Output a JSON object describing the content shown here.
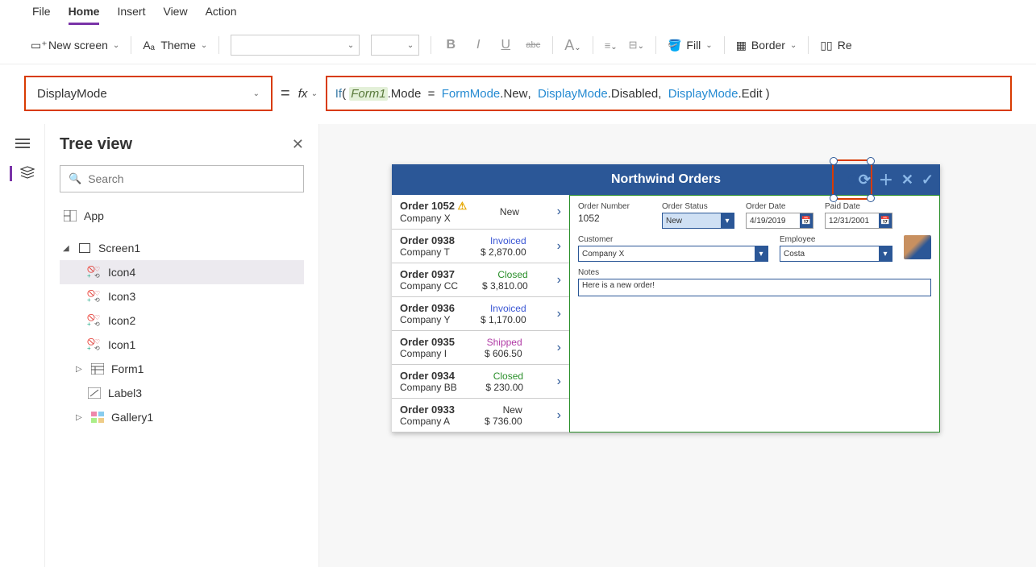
{
  "menu": {
    "file": "File",
    "home": "Home",
    "insert": "Insert",
    "view": "View",
    "action": "Action"
  },
  "ribbon": {
    "new_screen": "New screen",
    "theme": "Theme",
    "fill": "Fill",
    "border": "Border",
    "reorder": "Re"
  },
  "prop_name": "DisplayMode",
  "formula": {
    "if": "If",
    "form1": "Form1",
    "mode": ".Mode",
    "eq": "  =  ",
    "formmode": "FormMode",
    "new": ".New",
    "c1": ",  ",
    "dm1": "DisplayMode",
    "dis": ".Disabled",
    "c2": ",  ",
    "dm2": "DisplayMode",
    "edit": ".Edit ",
    "open": "( ",
    "close": ")"
  },
  "tree": {
    "title": "Tree view",
    "search_ph": "Search",
    "app": "App",
    "screen1": "Screen1",
    "icon4": "Icon4",
    "icon3": "Icon3",
    "icon2": "Icon2",
    "icon1": "Icon1",
    "form1": "Form1",
    "label3": "Label3",
    "gallery1": "Gallery1"
  },
  "app": {
    "title": "Northwind Orders",
    "orders": [
      {
        "num": "Order 1052",
        "cust": "Company X",
        "status": "New",
        "amount": "",
        "warn": true
      },
      {
        "num": "Order 0938",
        "cust": "Company T",
        "status": "Invoiced",
        "amount": "$ 2,870.00"
      },
      {
        "num": "Order 0937",
        "cust": "Company CC",
        "status": "Closed",
        "amount": "$ 3,810.00"
      },
      {
        "num": "Order 0936",
        "cust": "Company Y",
        "status": "Invoiced",
        "amount": "$ 1,170.00"
      },
      {
        "num": "Order 0935",
        "cust": "Company I",
        "status": "Shipped",
        "amount": "$ 606.50"
      },
      {
        "num": "Order 0934",
        "cust": "Company BB",
        "status": "Closed",
        "amount": "$ 230.00"
      },
      {
        "num": "Order 0933",
        "cust": "Company A",
        "status": "New",
        "amount": "$ 736.00"
      }
    ],
    "form": {
      "order_number_l": "Order Number",
      "order_number": "1052",
      "order_status_l": "Order Status",
      "order_status": "New",
      "order_date_l": "Order Date",
      "order_date": "4/19/2019",
      "paid_date_l": "Paid Date",
      "paid_date": "12/31/2001",
      "customer_l": "Customer",
      "customer": "Company X",
      "employee_l": "Employee",
      "employee": "Costa",
      "notes_l": "Notes",
      "notes": "Here is a new order!"
    }
  }
}
